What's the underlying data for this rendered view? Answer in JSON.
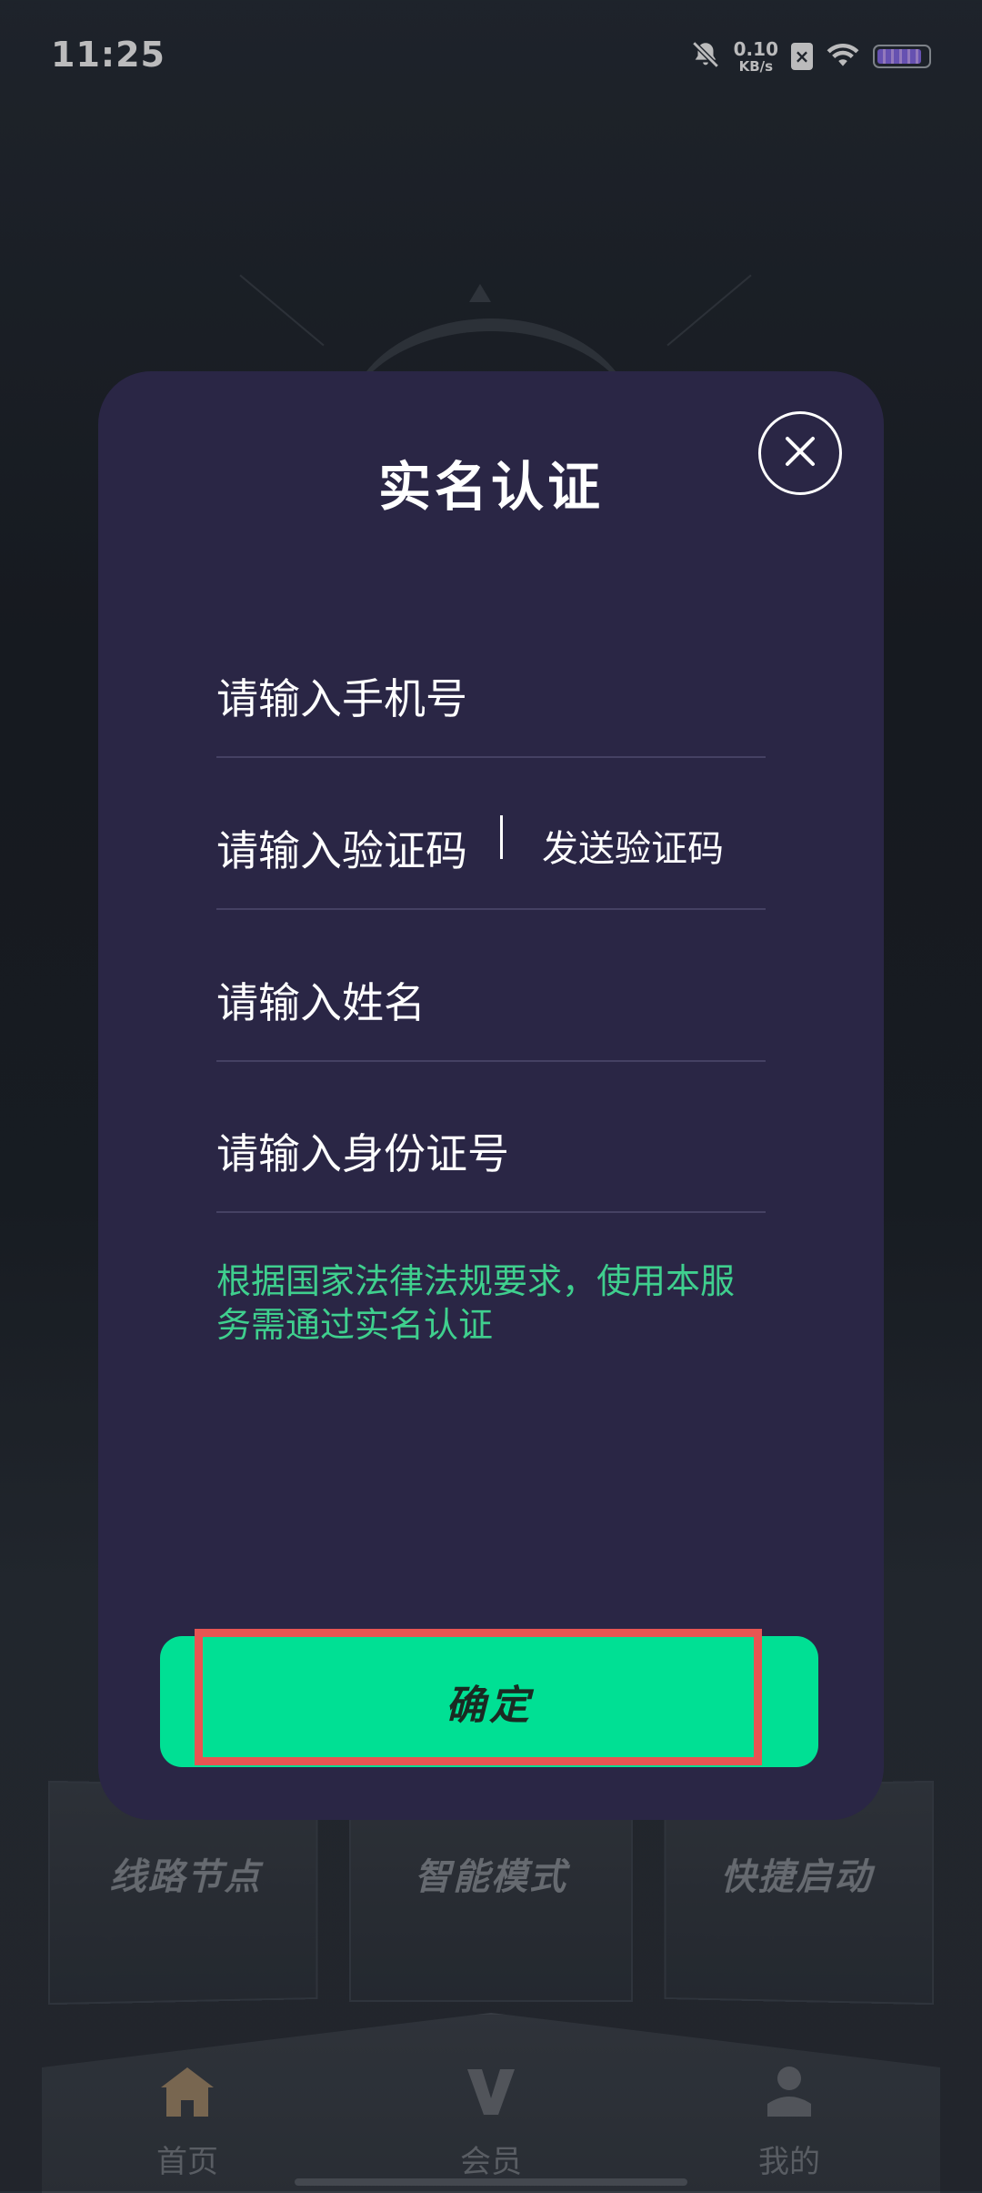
{
  "status_bar": {
    "time": "11:25",
    "net_speed_value": "0.10",
    "net_speed_unit": "KB/s",
    "sim_label": "×"
  },
  "background": {
    "feature_cards": [
      {
        "label": "线路节点"
      },
      {
        "label": "智能模式"
      },
      {
        "label": "快捷启动"
      }
    ]
  },
  "bottom_nav": {
    "items": [
      {
        "label": "首页",
        "icon": "home-icon"
      },
      {
        "label": "会员",
        "icon": "vip-icon"
      },
      {
        "label": "我的",
        "icon": "profile-icon"
      }
    ]
  },
  "modal": {
    "title": "实名认证",
    "close_icon": "close-icon",
    "phone_placeholder": "请输入手机号",
    "code_placeholder": "请输入验证码",
    "send_code_label": "发送验证码",
    "name_placeholder": "请输入姓名",
    "id_placeholder": "请输入身份证号",
    "notice": "根据国家法律法规要求，使用本服务需通过实名认证",
    "confirm_label": "确定"
  },
  "colors": {
    "modal_bg": "#2a2645",
    "accent_green": "#00e094",
    "notice_green": "#3fcf8e",
    "highlight_red": "#e85552"
  }
}
